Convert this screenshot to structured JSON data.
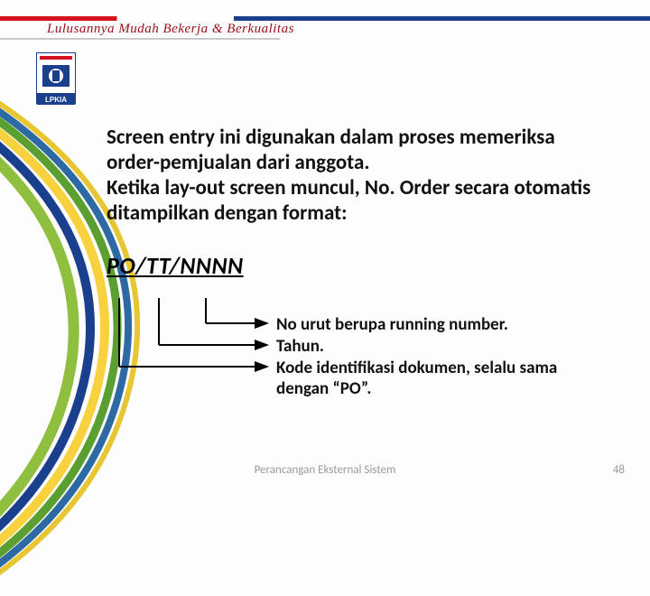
{
  "header": {
    "tagline": "Lulusannya Mudah Bekerja & Berkualitas",
    "logo_label": "LPKIA"
  },
  "body": {
    "paragraph1": "Screen entry ini digunakan dalam proses memeriksa order-pemjualan dari anggota.",
    "paragraph2": "Ketika lay-out screen muncul, No. Order secara otomatis ditampilkan dengan format:",
    "code": "PO/TT/NNNN",
    "explanations": [
      "No urut berupa running number.",
      "Tahun.",
      "Kode identifikasi dokumen, selalu sama dengan “PO”."
    ]
  },
  "footer": {
    "text": "Perancangan Eksternal Sistem",
    "page": "48"
  }
}
